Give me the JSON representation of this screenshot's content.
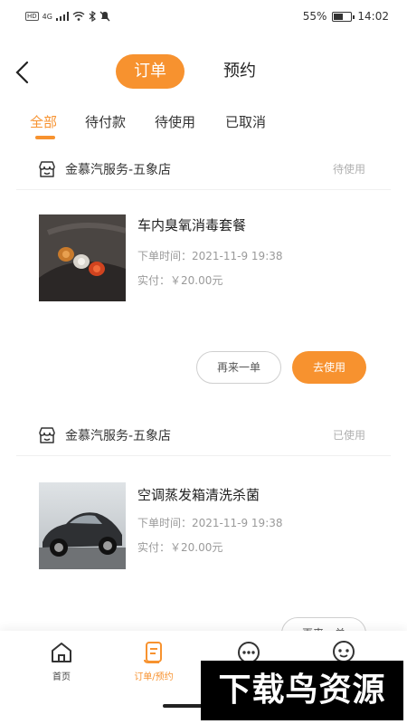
{
  "status_bar": {
    "battery": "55%",
    "battery_level": 0.55,
    "time": "14:02",
    "network": "4G"
  },
  "header": {
    "tab_order": "订单",
    "tab_reserve": "预约",
    "accent": "#f7922f"
  },
  "filters": [
    "全部",
    "待付款",
    "待使用",
    "已取消"
  ],
  "orders": [
    {
      "store": "金慕汽服务-五象店",
      "status": "待使用",
      "title": "车内臭氧消毒套餐",
      "order_time": "下单时间：2021-11-9 19:38",
      "paid": "实付：￥20.00元",
      "btn_again": "再来一单",
      "btn_use": "去使用"
    },
    {
      "store": "金慕汽服务-五象店",
      "status": "已使用",
      "title": "空调蒸发箱清洗杀菌",
      "order_time": "下单时间：2021-11-9 19:38",
      "paid": "实付：￥20.00元",
      "btn_again": "再来一单"
    }
  ],
  "bottom_nav": [
    {
      "label": "首页",
      "icon": "home-icon"
    },
    {
      "label": "订单/预约",
      "icon": "order-icon"
    },
    {
      "label": "",
      "icon": "more-icon"
    },
    {
      "label": "",
      "icon": "chat-icon"
    }
  ],
  "watermark": "下载鸟资源"
}
